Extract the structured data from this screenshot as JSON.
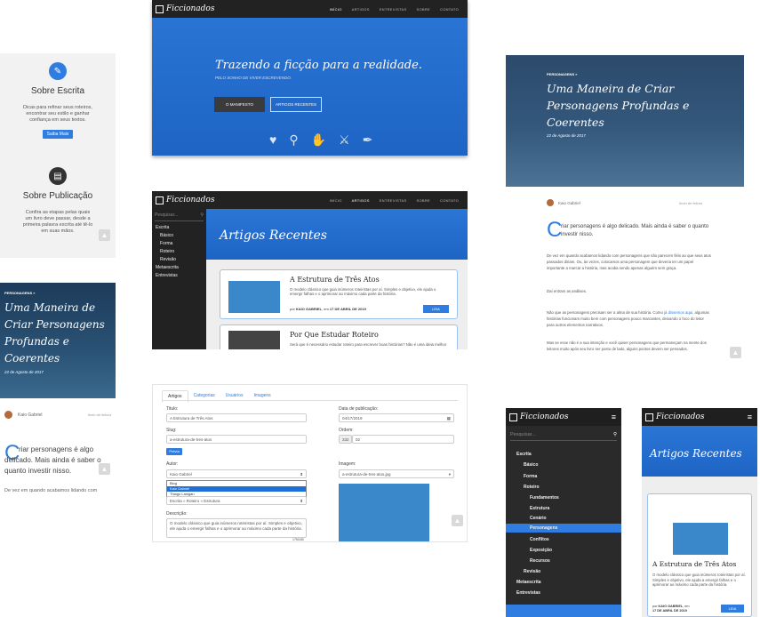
{
  "brand": {
    "name": "Ficcionados"
  },
  "nav": [
    "INÍCIO",
    "ARTIGOS",
    "ENTREVISTAS",
    "SOBRE",
    "CONTATO"
  ],
  "cards": {
    "escrita": {
      "title": "Sobre Escrita",
      "text": "Dicas para refinar seus roteiros, encontrar seu estilo e ganhar confiança em seus textos.",
      "button": "Saiba Mais",
      "icon": "feather-icon"
    },
    "publicacao": {
      "title": "Sobre Publicação",
      "text": "Confira as etapas pelas quais um livro deve passar, desde a primeira palavra escrita até tê-lo em suas mãos.",
      "icon": "book-icon"
    }
  },
  "hero": {
    "title": "Trazendo a ficção para a realidade.",
    "subtitle": "PELO SONHO DE VIVER ESCREVENDO.",
    "btn_manifesto": "O MANIFESTO",
    "btn_artigos": "ARTIGOS RECENTES",
    "icons": [
      "heart-icon",
      "magnifier-icon",
      "hands-icon",
      "sword-icon",
      "quill-icon"
    ]
  },
  "articles_page": {
    "search_placeholder": "Pesquisar...",
    "heading": "Artigos Recentes",
    "sidebar": [
      "Escrita",
      "Básico",
      "Forma",
      "Roteiro",
      "Revisão",
      "Metaescrita",
      "Entrevistas"
    ],
    "articles": [
      {
        "title": "A Estrutura de Três Atos",
        "excerpt": "O modelo clássico que guia inúmeros roteiristas por aí. Simples e objetivo, ele ajuda o emergir falhas e o aprimorar ao máximo cada parte da história.",
        "author": "KAIO GABRIEL",
        "date": "17 DE ABRIL DE 2019",
        "button": "LEIA"
      },
      {
        "title": "Por Que Estudar Roteiro",
        "excerpt": "Será que é necessário estudar roteiro para escrever boas histórias? Não é uma ideia melhor"
      }
    ]
  },
  "post": {
    "category": "PERSONAGENS »",
    "title": "Uma Maneira de Criar Personagens Profundas e Coerentes",
    "date": "22 de Agosto de 2017",
    "author": "Kaio Gabriel",
    "reading_time": "6min de leitura",
    "dropcap": "C",
    "lead": "riar personagens é algo delicado. Mais ainda é saber o quanto investir nisso.",
    "mobile_fragment": "De vez em quando acabamos lidando com",
    "p1": "De vez em quando acabamos lidando com personagens que não parecem fiéis ao que seus atos passados diriam. Ou, às vezes, colocamos uma personagem que deveria ter um papel importante a marcar a história, mas acaba sendo apenas alguém sem graça.",
    "p2": "Daí entram as análises.",
    "p3a": "Não que as personagens precisam ser a alma de sua história. Como",
    "p3link": "já dissemos aqui",
    "p3b": ", algumas histórias funcionam muito bem com personagens pouco marcantes, deixando o foco do leitor para outros elementos narrativos.",
    "p4": "Mas se esse não é a sua intenção e você quiser personagens que permaneçam na mente dos leitores muito após seu livro ser posto de lado, alguns pontos devem ser pensados."
  },
  "admin": {
    "tabs": [
      "Artigos",
      "Categorias",
      "Usuários",
      "Imagens"
    ],
    "titulo_label": "Titulo:",
    "titulo_value": "A Estrutura de Três Atos",
    "data_label": "Data de publicação:",
    "data_value": "04/17/2019",
    "slug_label": "Slug:",
    "slug_value": "a-estrutura-de-tres-atos",
    "ordem_label": "Ordem:",
    "ordem_a": "332",
    "ordem_b": "02",
    "preview": "Prévia",
    "autor_label": "Autor:",
    "autor_value": "Kaio Gabriel",
    "autor_options": [
      "Blog",
      "Kaio Gabriel",
      "Thiago Lanigan"
    ],
    "categoria_value": "Escrita » Roteiro » Estrutura",
    "imagem_label": "Imagem:",
    "imagem_value": "a-estrutura-de-tres-atos.jpg",
    "descricao_label": "Descrição:",
    "descricao_value": "O modelo clássico que guia inúmeros roteiristas por aí. Simples e objetivo, ele ajuda o emergir falhas e o aprimorar ao máximo cada parte da história.",
    "char_count": "175/180"
  },
  "mobile_nav": {
    "search_placeholder": "Pesquisar...",
    "items": [
      "Escrita",
      "Básico",
      "Forma",
      "Roteiro",
      "Fundamentos",
      "Estrutura",
      "Cenário",
      "Personagens",
      "Conflitos",
      "Exposição",
      "Recursos",
      "Revisão",
      "Metaescrita",
      "Entrevistas"
    ]
  },
  "mobile_list": {
    "heading": "Artigos Recentes",
    "article_title": "A Estrutura de Três Atos",
    "excerpt": "O modelo clássico que guia inúmeros roteiristas por aí. Simples e objetivo, ele ajuda a emergir falhas e o aprimorar ao máximo cada parte da história.",
    "author": "KAIO GABRIEL",
    "date": "17 DE ABRIL DE 2019",
    "button": "LEIA"
  },
  "colors": {
    "accent": "#2f7de1",
    "dark": "#222222",
    "hero_blue": "#1e64c5"
  }
}
